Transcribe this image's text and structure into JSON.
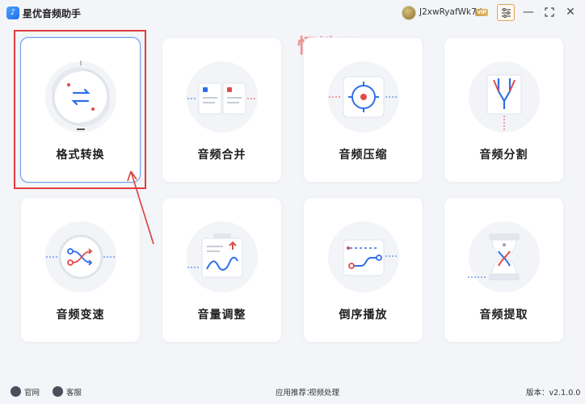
{
  "app": {
    "title": "星优音频助手",
    "logo_icon": "music-note-icon"
  },
  "user": {
    "name": "J2xwRyafWk7d",
    "badge": "VIP"
  },
  "watermark": "恒浩网",
  "features": [
    {
      "label": "格式转换",
      "icon": "format-convert-icon",
      "selected": true
    },
    {
      "label": "音频合并",
      "icon": "audio-merge-icon"
    },
    {
      "label": "音频压缩",
      "icon": "audio-compress-icon"
    },
    {
      "label": "音频分割",
      "icon": "audio-split-icon"
    },
    {
      "label": "音频变速",
      "icon": "audio-speed-icon"
    },
    {
      "label": "音量调整",
      "icon": "volume-adjust-icon"
    },
    {
      "label": "倒序播放",
      "icon": "reverse-play-icon"
    },
    {
      "label": "音频提取",
      "icon": "audio-extract-icon"
    }
  ],
  "footer": {
    "website": "官网",
    "support": "客服",
    "recommend_label": "应用推荐：",
    "recommend_app": "视频处理",
    "version": "版本：v2.1.0.0"
  },
  "colors": {
    "accent": "#2f6fe8",
    "highlight": "#e23b3b",
    "settings_border": "#e1a35a"
  }
}
